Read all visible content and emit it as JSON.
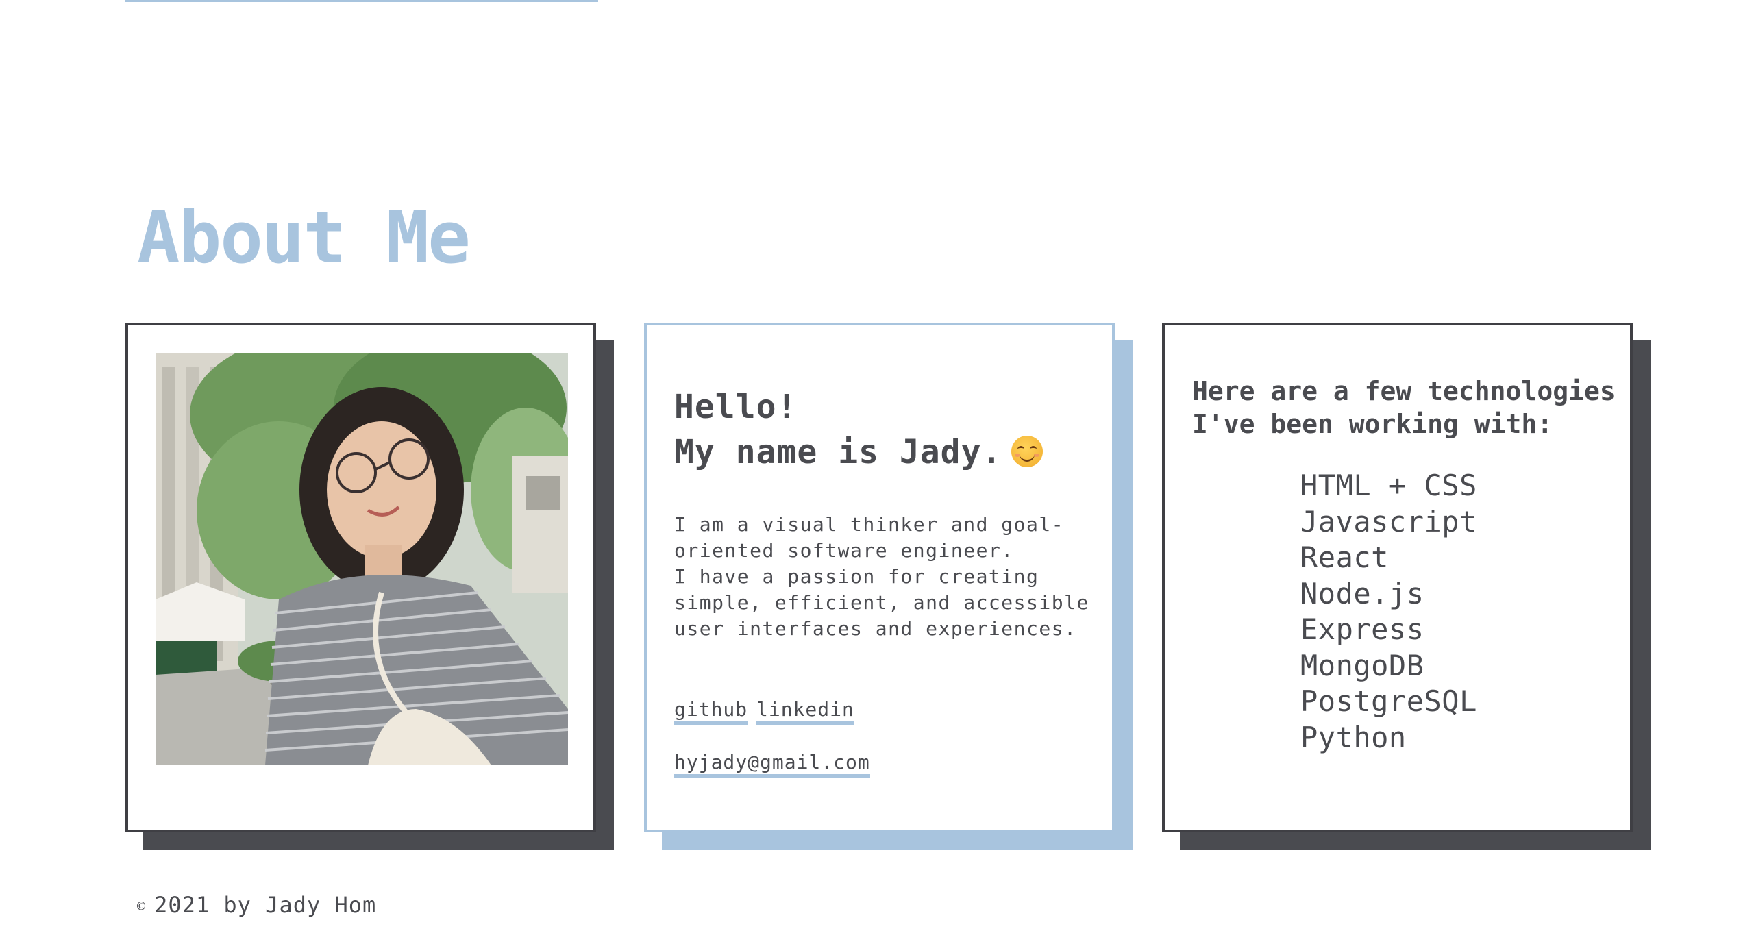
{
  "section": {
    "title": "About Me"
  },
  "intro": {
    "greeting_line1": "Hello!",
    "greeting_line2": "My name is Jady.",
    "emoji": "smiling-face",
    "bio_lines": [
      "I am a visual thinker and goal-",
      "oriented software engineer.",
      "I have a passion for creating",
      "simple, efficient, and accessible",
      "user interfaces and experiences."
    ],
    "links": {
      "github": "github",
      "linkedin": "linkedin",
      "email": "hyjady@gmail.com"
    }
  },
  "tech": {
    "heading_line1": "Here are a few technologies",
    "heading_line2": "I've been working with:",
    "items": [
      "HTML + CSS",
      "Javascript",
      "React",
      "Node.js",
      "Express",
      "MongoDB",
      "PostgreSQL",
      "Python"
    ]
  },
  "footer": {
    "copyright_symbol": "©",
    "text": "2021 by Jady Hom"
  },
  "colors": {
    "accent": "#a8c4de",
    "dark": "#4a4b50"
  }
}
